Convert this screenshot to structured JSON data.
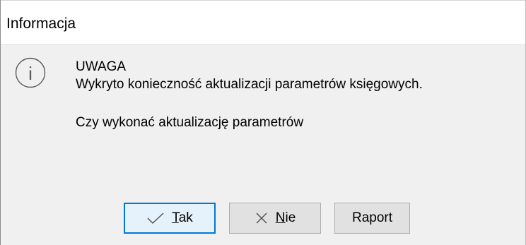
{
  "window": {
    "title": "Informacja"
  },
  "icon": {
    "name": "info-icon",
    "glyph": "i"
  },
  "message": {
    "heading": "UWAGA",
    "line1": "Wykryto konieczność aktualizacji parametrów księgowych.",
    "question": "Czy wykonać aktualizację parametrów"
  },
  "buttons": {
    "yes": {
      "first": "T",
      "rest": "ak",
      "icon": "check-icon",
      "default": true
    },
    "no": {
      "first": "N",
      "rest": "ie",
      "icon": "cross-icon"
    },
    "report": {
      "label": "Raport"
    }
  },
  "colors": {
    "default_button_border": "#0078d7",
    "default_button_bg": "#e5f1fb",
    "dialog_bg": "#f0f0f0",
    "icon_stroke": "#5a5a5a"
  }
}
